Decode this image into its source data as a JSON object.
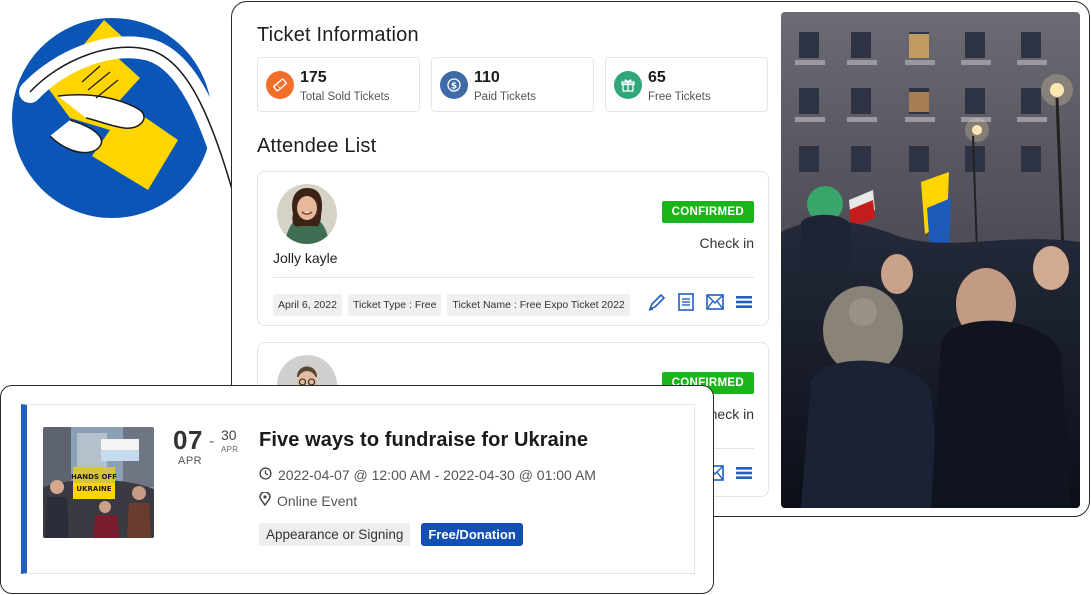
{
  "ticket_info": {
    "title": "Ticket Information",
    "stats": [
      {
        "value": "175",
        "label": "Total Sold Tickets",
        "icon": "ticket-icon",
        "color": "#f26f2b"
      },
      {
        "value": "110",
        "label": "Paid Tickets",
        "icon": "dollar-coin-icon",
        "color": "#3e6aa8"
      },
      {
        "value": "65",
        "label": "Free Tickets",
        "icon": "gift-icon",
        "color": "#2ea87a"
      }
    ]
  },
  "attendees": {
    "title": "Attendee List",
    "items": [
      {
        "name": "Jolly kayle",
        "status": "CONFIRMED",
        "action": "Check in",
        "date": "April 6, 2022",
        "ticket_type": "Ticket Type : Free",
        "ticket_name": "Ticket Name : Free Expo Ticket 2022"
      },
      {
        "name": "",
        "status": "CONFIRMED",
        "action": "Check in"
      }
    ]
  },
  "event": {
    "day_start": "07",
    "dash": "-",
    "day_end": "30",
    "month_start": "APR",
    "month_end": "APR",
    "title": "Five ways to fundraise for Ukraine",
    "datetime": "2022-04-07 @ 12:00 AM - 2022-04-30 @ 01:00 AM",
    "location": "Online Event",
    "tags": [
      "Appearance or Signing",
      "Free/Donation"
    ]
  },
  "colors": {
    "confirmed": "#1bb51b",
    "accent_blue": "#1f5fbf",
    "logo_blue": "#0a55b5",
    "logo_yellow": "#ffd500"
  }
}
